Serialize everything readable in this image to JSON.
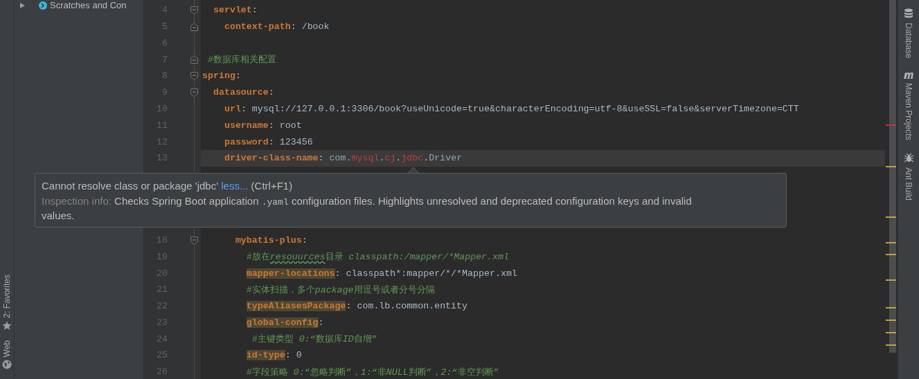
{
  "project_panel": {
    "items": [
      {
        "label": "Scratches and Con",
        "expanded": false
      }
    ]
  },
  "left_strip": {
    "items": [
      {
        "label": "2: Favorites",
        "kind": "star"
      },
      {
        "label": "Web",
        "kind": "globe"
      }
    ]
  },
  "right_strip": {
    "items": [
      {
        "label": "Database",
        "kind": "database"
      },
      {
        "label": "Maven Projects",
        "kind": "maven"
      },
      {
        "label": "Ant Build",
        "kind": "ant"
      }
    ]
  },
  "editor": {
    "lines": [
      {
        "number": "4",
        "fold": {
          "kind": "start"
        },
        "tokens": [
          {
            "kind": "key",
            "text": "  servlet"
          },
          {
            "kind": "punct",
            "text": ":"
          }
        ]
      },
      {
        "number": "5",
        "fold": {
          "kind": "end"
        },
        "tokens": [
          {
            "kind": "key",
            "text": "    context-path"
          },
          {
            "kind": "punct",
            "text": ": "
          },
          {
            "kind": "value",
            "text": "/book"
          }
        ]
      },
      {
        "number": "6"
      },
      {
        "number": "7",
        "fold": {
          "kind": "end"
        },
        "tokens": [
          {
            "kind": "comment",
            "text": " #数据库相关配置"
          }
        ]
      },
      {
        "number": "8",
        "fold": {
          "kind": "start"
        },
        "tokens": [
          {
            "kind": "key",
            "text": "spring"
          },
          {
            "kind": "punct",
            "text": ":"
          }
        ]
      },
      {
        "number": "9",
        "fold": {
          "kind": "start"
        },
        "tokens": [
          {
            "kind": "key",
            "text": "  datasource"
          },
          {
            "kind": "punct",
            "text": ":"
          }
        ]
      },
      {
        "number": "10",
        "tokens": [
          {
            "kind": "key",
            "text": "    url"
          },
          {
            "kind": "punct",
            "text": ": "
          },
          {
            "kind": "value",
            "text": "mysql://127.0.0.1:3306/book?useUnicode=true&characterEncoding=utf-8&useSSL=false&serverTimezone=CTT"
          }
        ]
      },
      {
        "number": "11",
        "tokens": [
          {
            "kind": "key",
            "text": "    username"
          },
          {
            "kind": "punct",
            "text": ": "
          },
          {
            "kind": "value",
            "text": "root"
          }
        ]
      },
      {
        "number": "12",
        "tokens": [
          {
            "kind": "key",
            "text": "    password"
          },
          {
            "kind": "punct",
            "text": ": "
          },
          {
            "kind": "value",
            "text": "123456"
          }
        ]
      },
      {
        "number": "13",
        "current": true,
        "tokens": [
          {
            "kind": "key",
            "text": "    driver-class-name"
          },
          {
            "kind": "punct",
            "text": ": "
          },
          {
            "kind": "class",
            "text": "com"
          },
          {
            "kind": "value",
            "text": "."
          },
          {
            "kind": "error",
            "text": "mysql"
          },
          {
            "kind": "value",
            "text": "."
          },
          {
            "kind": "error",
            "text": "cj"
          },
          {
            "kind": "value",
            "text": "."
          },
          {
            "kind": "error",
            "text": "jdbc"
          },
          {
            "kind": "value",
            "text": "."
          },
          {
            "kind": "class",
            "text": "Driver"
          }
        ]
      }
    ],
    "lines_below": [
      {
        "number": "18",
        "fold": {
          "kind": "start"
        },
        "tokens": [
          {
            "kind": "key",
            "text": "      mybatis-plus"
          },
          {
            "kind": "punct",
            "text": ":"
          }
        ]
      },
      {
        "number": "19",
        "tokens": [
          {
            "kind": "comment",
            "text": "        #放在"
          },
          {
            "kind": "typo",
            "text": "resouurces"
          },
          {
            "kind": "comment",
            "text": "目录 "
          },
          {
            "kind": "comment-italic",
            "text": "classpath:/mapper/*Mapper.xml"
          }
        ]
      },
      {
        "number": "20",
        "tokens": [
          {
            "kind": "key",
            "text": "        mapper-locations",
            "highlighted": true
          },
          {
            "kind": "punct",
            "text": ": "
          },
          {
            "kind": "value",
            "text": "classpath*:mapper/*/*Mapper.xml"
          }
        ]
      },
      {
        "number": "21",
        "tokens": [
          {
            "kind": "comment",
            "text": "        #实体扫描，多个"
          },
          {
            "kind": "comment-italic",
            "text": "package"
          },
          {
            "kind": "comment",
            "text": "用逗号或者分号分隔"
          }
        ]
      },
      {
        "number": "22",
        "tokens": [
          {
            "kind": "key",
            "text": "        typeAliasesPackage",
            "highlighted": true
          },
          {
            "kind": "punct",
            "text": ": "
          },
          {
            "kind": "value",
            "text": "com.lb.common.entity"
          }
        ]
      },
      {
        "number": "23",
        "tokens": [
          {
            "kind": "key",
            "text": "        global-config",
            "highlighted": true
          },
          {
            "kind": "punct",
            "text": ":"
          }
        ]
      },
      {
        "number": "24",
        "tokens": [
          {
            "kind": "comment",
            "text": "         #主键类型 "
          },
          {
            "kind": "comment-italic",
            "text": "0:"
          },
          {
            "kind": "comment",
            "text": "“数据库"
          },
          {
            "kind": "comment-italic",
            "text": "ID"
          },
          {
            "kind": "comment",
            "text": "自增”"
          }
        ]
      },
      {
        "number": "25",
        "tokens": [
          {
            "kind": "key",
            "text": "        id-type",
            "highlighted": true
          },
          {
            "kind": "punct",
            "text": ": "
          },
          {
            "kind": "value",
            "text": "0"
          }
        ]
      },
      {
        "number": "26",
        "tokens": [
          {
            "kind": "comment",
            "text": "        #字段策略 "
          },
          {
            "kind": "comment-italic",
            "text": "0:"
          },
          {
            "kind": "comment",
            "text": "“忽略判断”，"
          },
          {
            "kind": "comment-italic",
            "text": "1:"
          },
          {
            "kind": "comment",
            "text": "“非"
          },
          {
            "kind": "comment-italic",
            "text": "NULL"
          },
          {
            "kind": "comment",
            "text": "判断”，"
          },
          {
            "kind": "comment-italic",
            "text": "2:"
          },
          {
            "kind": "comment",
            "text": "“非空判断”"
          }
        ]
      }
    ]
  },
  "tooltip": {
    "message": "Cannot resolve class or package 'jdbc' ",
    "link": "less...",
    "shortcut": " (Ctrl+F1)",
    "info": {
      "label": "Inspection info:",
      "before": " Checks Spring Boot application ",
      "code": ".yaml",
      "after": " configuration files. Highlights unresolved and deprecated configuration keys and invalid values."
    }
  }
}
